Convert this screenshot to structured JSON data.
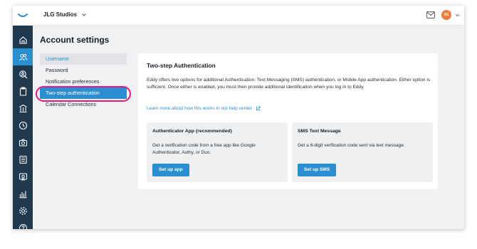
{
  "header": {
    "org_name": "JLG Studios",
    "avatar_initials": "SG"
  },
  "page": {
    "title": "Account settings"
  },
  "settings_nav": [
    {
      "label": "Username"
    },
    {
      "label": "Password"
    },
    {
      "label": "Notification preferences"
    },
    {
      "label": "Two-step authentication"
    },
    {
      "label": "Calendar Connections"
    }
  ],
  "two_step": {
    "heading": "Two-step Authentication",
    "description": "Eddy offers two options for additional Authentication: Text Messaging (SMS) authentication, or Mobile App authentication. Either option is sufficient. Once either is enabled, you must then provide additional identification when you log in to Eddy.",
    "learn_more": "Learn more about how this works in our help center.",
    "options": [
      {
        "title": "Authenticator App (recommended)",
        "text": "Get a verification code from a free app like Google Authenticator, Authy, or Duo.",
        "button": "Set up app"
      },
      {
        "title": "SMS Text Message",
        "text": "Get a 6-digit verification code sent via text message.",
        "button": "Set up SMS"
      }
    ]
  },
  "colors": {
    "accent": "#2a8fd0",
    "sidebar": "#1f3a4f",
    "highlight": "#e5197d",
    "avatar": "#f07a3a"
  },
  "sidebar_icons": [
    "home-icon",
    "people-icon",
    "search-person-icon",
    "clipboard-icon",
    "building-icon",
    "clock-icon",
    "camera-icon",
    "newspaper-icon",
    "certificate-icon",
    "bar-chart-icon",
    "gear-icon",
    "help-icon"
  ]
}
